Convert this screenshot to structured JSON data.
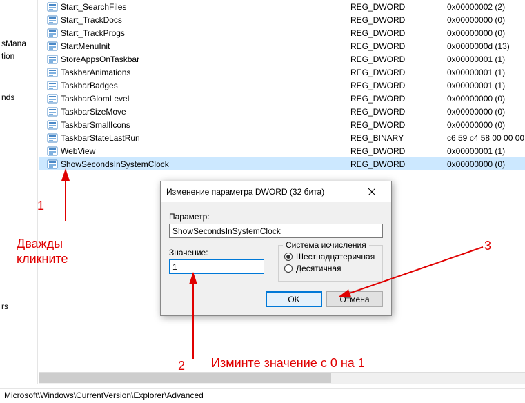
{
  "tree": {
    "items": [
      "sMana",
      "tion",
      "",
      "",
      "nds",
      "",
      "",
      "",
      "",
      "",
      "",
      "",
      "rs"
    ]
  },
  "registry": {
    "rows": [
      {
        "name": "Start_SearchFiles",
        "type": "REG_DWORD",
        "data": "0x00000002 (2)",
        "selected": false
      },
      {
        "name": "Start_TrackDocs",
        "type": "REG_DWORD",
        "data": "0x00000000 (0)",
        "selected": false
      },
      {
        "name": "Start_TrackProgs",
        "type": "REG_DWORD",
        "data": "0x00000000 (0)",
        "selected": false
      },
      {
        "name": "StartMenuInit",
        "type": "REG_DWORD",
        "data": "0x0000000d (13)",
        "selected": false
      },
      {
        "name": "StoreAppsOnTaskbar",
        "type": "REG_DWORD",
        "data": "0x00000001 (1)",
        "selected": false
      },
      {
        "name": "TaskbarAnimations",
        "type": "REG_DWORD",
        "data": "0x00000001 (1)",
        "selected": false
      },
      {
        "name": "TaskbarBadges",
        "type": "REG_DWORD",
        "data": "0x00000001 (1)",
        "selected": false
      },
      {
        "name": "TaskbarGlomLevel",
        "type": "REG_DWORD",
        "data": "0x00000000 (0)",
        "selected": false
      },
      {
        "name": "TaskbarSizeMove",
        "type": "REG_DWORD",
        "data": "0x00000000 (0)",
        "selected": false
      },
      {
        "name": "TaskbarSmallIcons",
        "type": "REG_DWORD",
        "data": "0x00000000 (0)",
        "selected": false
      },
      {
        "name": "TaskbarStateLastRun",
        "type": "REG_BINARY",
        "data": "c6 59 c4 58 00 00 00",
        "selected": false
      },
      {
        "name": "WebView",
        "type": "REG_DWORD",
        "data": "0x00000001 (1)",
        "selected": false
      },
      {
        "name": "ShowSecondsInSystemClock",
        "type": "REG_DWORD",
        "data": "0x00000000 (0)",
        "selected": true
      }
    ]
  },
  "dialog": {
    "title": "Изменение параметра DWORD (32 бита)",
    "param_label": "Параметр:",
    "param_value": "ShowSecondsInSystemClock",
    "value_label": "Значение:",
    "value_value": "1",
    "base_legend": "Система исчисления",
    "radio_hex": "Шестнадцатеричная",
    "radio_dec": "Десятичная",
    "ok": "OK",
    "cancel": "Отмена"
  },
  "status": {
    "path": "Microsoft\\Windows\\CurrentVersion\\Explorer\\Advanced"
  },
  "anno": {
    "n1": "1",
    "n2": "2",
    "n3": "3",
    "double_click": "Дважды\nкликните",
    "change_value": "Изминте значение с 0 на 1"
  }
}
